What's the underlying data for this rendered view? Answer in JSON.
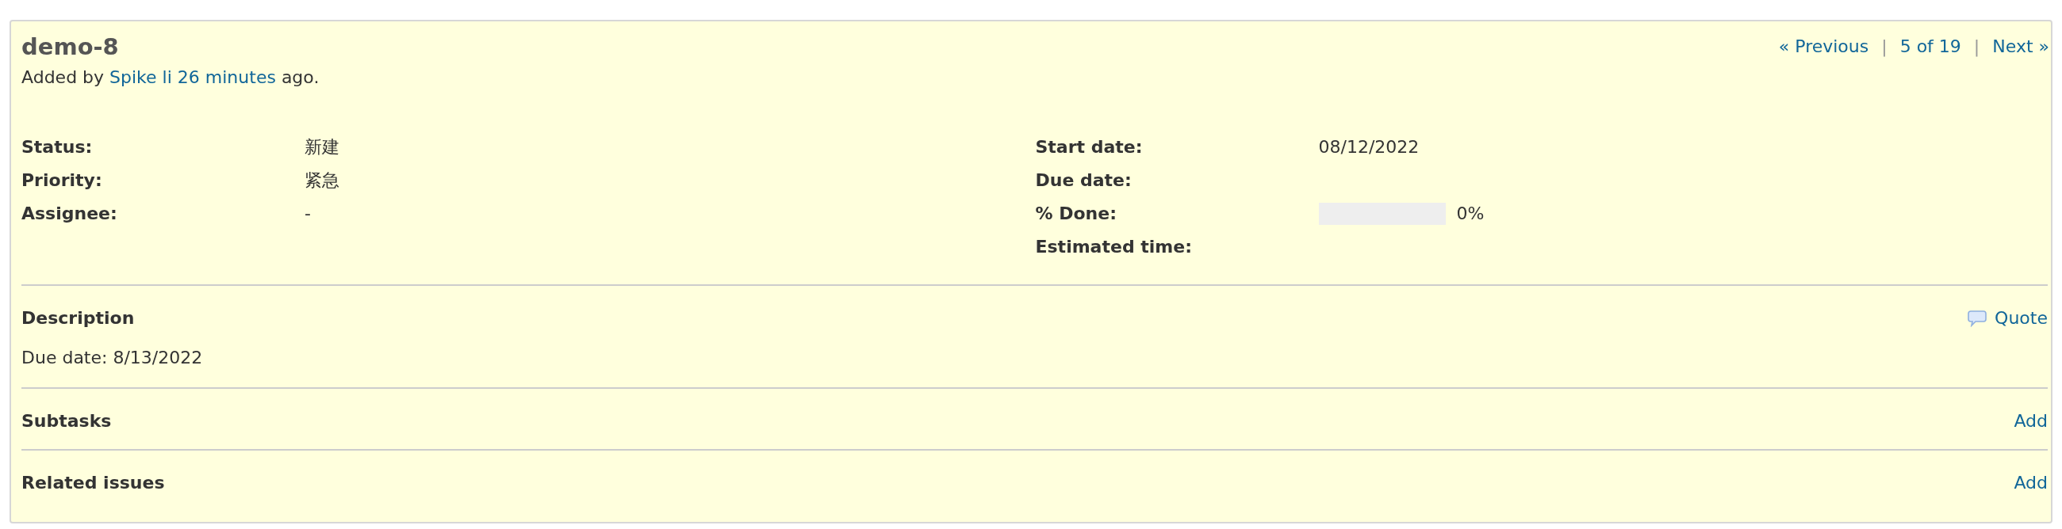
{
  "issue": {
    "title": "demo-8",
    "author_line": {
      "prefix": "Added by",
      "author": "Spike li",
      "age": "26 minutes",
      "suffix": "ago."
    }
  },
  "navigation": [
    {
      "kind": "link",
      "text": "« Previous"
    },
    {
      "kind": "separator",
      "text": "|"
    },
    {
      "kind": "link",
      "text": "5 of 19"
    },
    {
      "kind": "separator",
      "text": "|"
    },
    {
      "kind": "link",
      "text": "Next »"
    }
  ],
  "attributes_left": [
    {
      "kind": "text",
      "label": "Status:",
      "value": "新建"
    },
    {
      "kind": "text",
      "label": "Priority:",
      "value": "紧急"
    },
    {
      "kind": "text",
      "label": "Assignee:",
      "value": "-"
    }
  ],
  "attributes_right": [
    {
      "kind": "text",
      "label": "Start date:",
      "value": "08/12/2022"
    },
    {
      "kind": "text",
      "label": "Due date:"
    },
    {
      "kind": "progress",
      "label": "% Done:",
      "level": 0,
      "reading": "0%"
    },
    {
      "kind": "text",
      "label": "Estimated time:"
    }
  ],
  "description": {
    "heading": "Description",
    "quote": "Quote",
    "text": "Due date: 8/13/2022"
  },
  "subtasks": {
    "heading": "Subtasks",
    "action": "Add"
  },
  "related_issues": {
    "heading": "Related issues",
    "action": "Add"
  }
}
